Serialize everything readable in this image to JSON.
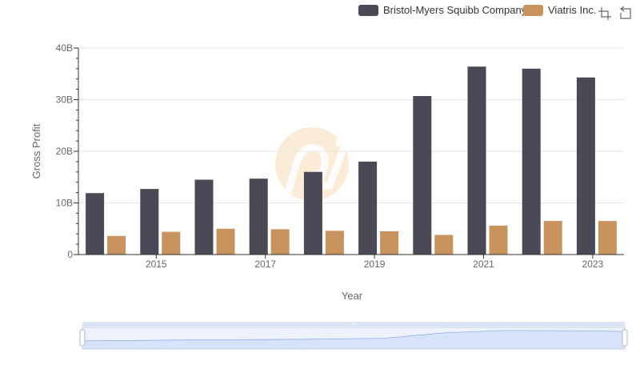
{
  "colors": {
    "bristol": "#4a4955",
    "viatris": "#c9935e",
    "grid": "#e6e6e6",
    "axis": "#333333",
    "text": "#666666",
    "watermark": "#f5dcb5",
    "slider_fill": "#d7e3fb",
    "slider_border": "#c3d0ea",
    "slider_line": "#92aee8",
    "slider_bar": "#dbe4f6"
  },
  "toolbar": {
    "zoom_icon": "data-zoom-icon",
    "reset_icon": "restore-icon"
  },
  "chart_data": {
    "type": "bar",
    "title": "",
    "xlabel": "Year",
    "ylabel": "Gross Profit",
    "categories": [
      "2014",
      "2015",
      "2016",
      "2017",
      "2018",
      "2019",
      "2020",
      "2021",
      "2022",
      "2023"
    ],
    "x_tick_labels": [
      "2015",
      "2017",
      "2019",
      "2021",
      "2023"
    ],
    "y_ticks": [
      "0",
      "10B",
      "20B",
      "30B",
      "40B"
    ],
    "ylim": [
      0,
      40
    ],
    "y_unit": "B",
    "grid": true,
    "legend_position": "top-right",
    "series": [
      {
        "name": "Bristol-Myers Squibb Company",
        "values": [
          11.9,
          12.7,
          14.5,
          14.7,
          16.0,
          18.0,
          30.7,
          36.4,
          36.0,
          34.3
        ]
      },
      {
        "name": "Viatris Inc.",
        "values": [
          3.6,
          4.4,
          5.0,
          4.9,
          4.6,
          4.5,
          3.8,
          5.6,
          6.5,
          6.5
        ]
      }
    ]
  }
}
